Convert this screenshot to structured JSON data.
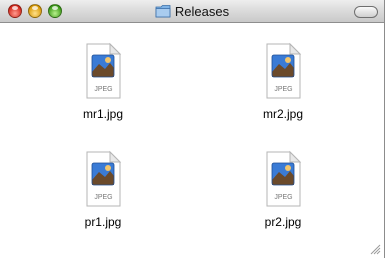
{
  "window": {
    "title": "Releases"
  },
  "files": [
    {
      "name": "mr1.jpg",
      "type_label": "JPEG"
    },
    {
      "name": "mr2.jpg",
      "type_label": "JPEG"
    },
    {
      "name": "pr1.jpg",
      "type_label": "JPEG"
    },
    {
      "name": "pr2.jpg",
      "type_label": "JPEG"
    }
  ],
  "icons": {
    "window_title": "folder-icon",
    "file": "jpeg-document-icon"
  }
}
